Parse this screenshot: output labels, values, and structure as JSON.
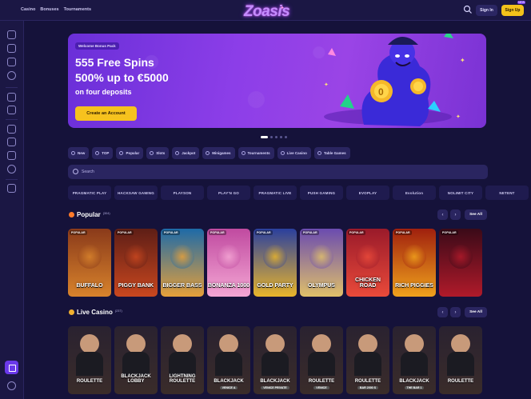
{
  "topnav": [
    "Casino",
    "Bonuses",
    "Tournaments"
  ],
  "logo": "Zoasis",
  "header": {
    "signin": "Sign In",
    "signup": "Sign Up",
    "signup_badge": "NEW"
  },
  "hero": {
    "badge": "Welcome Bonus Pack",
    "line1": "555 Free Spins",
    "line2": "500% up to €5000",
    "line3": "on four deposits",
    "cta": "Create an Account"
  },
  "categories": [
    "New",
    "TOP",
    "Popular",
    "Slots",
    "Jackpot",
    "Minigames",
    "Tournaments",
    "Live Casino",
    "Table Games"
  ],
  "search": {
    "placeholder": "Search"
  },
  "providers": [
    "PRAGMATIC PLAY",
    "HACKSAW GAMING",
    "PLAYSON",
    "PLAY'N GO",
    "PRAGMATIC LIVE",
    "PUSH GAMING",
    "EVOPLAY",
    "Evolution",
    "NOLIMIT CITY",
    "NETENT",
    "PLAYTECH"
  ],
  "popular": {
    "title": "Popular",
    "count": "(304)",
    "see_all": "See All",
    "games": [
      {
        "tag": "POPULAR",
        "title": "BUFFALO",
        "c1": "#8a3a1a",
        "c2": "#d8832c"
      },
      {
        "tag": "POPULAR",
        "title": "PIGGY BANK",
        "c1": "#5e1e16",
        "c2": "#c9471f"
      },
      {
        "tag": "POPULAR",
        "title": "BIGGER BASS",
        "c1": "#1d6aa8",
        "c2": "#e6a03a"
      },
      {
        "tag": "POPULAR",
        "title": "BONANZA 1000",
        "c1": "#c04aa0",
        "c2": "#f4a6d4"
      },
      {
        "tag": "POPULAR",
        "title": "GOLD PARTY",
        "c1": "#2a3f9e",
        "c2": "#e9b52b"
      },
      {
        "tag": "POPULAR",
        "title": "OLYMPUS",
        "c1": "#6a4bb0",
        "c2": "#e0c06a"
      },
      {
        "tag": "POPULAR",
        "title": "CHICKEN ROAD",
        "c1": "#9a1a2a",
        "c2": "#e94a3a"
      },
      {
        "tag": "POPULAR",
        "title": "RICH PIGGIES",
        "c1": "#a0200e",
        "c2": "#f0a21c"
      },
      {
        "tag": "POPULAR",
        "title": "",
        "c1": "#3a0a18",
        "c2": "#b01a2a"
      }
    ]
  },
  "live_casino": {
    "title": "Live Casino",
    "count": "(237)",
    "see_all": "See All",
    "games": [
      {
        "title": "ROULETTE",
        "sub": ""
      },
      {
        "title": "BLACKJACK LOBBY",
        "sub": ""
      },
      {
        "title": "LIGHTNING ROULETTE",
        "sub": ""
      },
      {
        "title": "BLACKJACK",
        "sub": "VENICE A"
      },
      {
        "title": "BLACKJACK",
        "sub": "VENICE PRIVATE"
      },
      {
        "title": "ROULETTE",
        "sub": "VENICE"
      },
      {
        "title": "ROULETTE",
        "sub": "BAR 2000 S"
      },
      {
        "title": "BLACKJACK",
        "sub": "THE BAR 1"
      },
      {
        "title": "ROULETTE",
        "sub": ""
      }
    ]
  },
  "language": "EN",
  "colors": {
    "accent": "#6a39ea",
    "cta": "#f6c21e",
    "bg": "#15123a",
    "panel": "#1b1744"
  }
}
